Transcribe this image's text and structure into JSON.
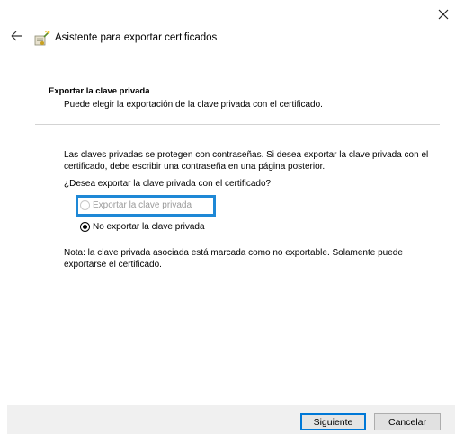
{
  "window": {
    "title": "Asistente para exportar certificados",
    "close_icon": "close-icon",
    "back_icon": "back-arrow-icon",
    "app_icon": "certificate-wizard-icon"
  },
  "section": {
    "title": "Exportar la clave privada",
    "subtitle": "Puede elegir la exportación de la clave privada con el certificado."
  },
  "content": {
    "description": "Las claves privadas se protegen con contraseñas. Si desea exportar la clave privada con el certificado, debe escribir una contraseña en una página posterior.",
    "question": "¿Desea exportar la clave privada con el certificado?",
    "options": [
      {
        "label": "Exportar la clave privada",
        "selected": false,
        "enabled": false
      },
      {
        "label": "No exportar la clave privada",
        "selected": true,
        "enabled": true
      }
    ],
    "note": "Nota: la clave privada asociada está marcada como no exportable. Solamente puede exportarse el certificado."
  },
  "buttons": {
    "next": "Siguiente",
    "cancel": "Cancelar"
  },
  "colors": {
    "highlight": "#1e88d6",
    "default_button_border": "#0078d7",
    "footer_bg": "#f0f0f0"
  }
}
